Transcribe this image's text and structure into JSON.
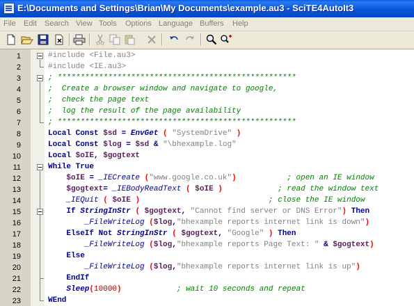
{
  "window": {
    "title": "E:\\Documents and Settings\\Brian\\My Documents\\example.au3 - SciTE4AutoIt3"
  },
  "menu": {
    "items": [
      "File",
      "Edit",
      "Search",
      "View",
      "Tools",
      "Options",
      "Language",
      "Buffers",
      "Help"
    ]
  },
  "toolbar": {
    "buttons": [
      "new-file-icon",
      "open-folder-icon",
      "save-icon",
      "close-file-icon",
      "print-icon",
      "cut-icon",
      "copy-icon",
      "paste-icon",
      "delete-icon",
      "undo-icon",
      "redo-icon",
      "find-icon",
      "replace-icon"
    ]
  },
  "colors": {
    "title_bar": "#0a55dd",
    "keyword": "#000090",
    "comment": "#008000",
    "string": "#808080",
    "variable": "#5a1e5a",
    "paren": "#ff0000",
    "number": "#a00000"
  },
  "editor": {
    "lines": [
      [
        [
          "i",
          "#include "
        ],
        [
          "s",
          "<File.au3>"
        ]
      ],
      [
        [
          "i",
          "#include "
        ],
        [
          "s",
          "<IE.au3>"
        ]
      ],
      [
        [
          "c",
          "; ****************************************************"
        ]
      ],
      [
        [
          "c",
          ";  Create a browser window and navigate to google,"
        ]
      ],
      [
        [
          "c",
          ";  check the page text"
        ]
      ],
      [
        [
          "c",
          ";  log the result of the page availability"
        ]
      ],
      [
        [
          "c",
          "; ****************************************************"
        ]
      ],
      [
        [
          "k",
          "Local Const "
        ],
        [
          "v",
          "$sd"
        ],
        [
          "o",
          " = "
        ],
        [
          "f",
          "EnvGet"
        ],
        [
          "p",
          " ( "
        ],
        [
          "s",
          "\"SystemDrive\""
        ],
        [
          "p",
          " )"
        ]
      ],
      [
        [
          "k",
          "Local Const "
        ],
        [
          "v",
          "$log"
        ],
        [
          "o",
          " = "
        ],
        [
          "v",
          "$sd"
        ],
        [
          "o",
          " & "
        ],
        [
          "s",
          "\"\\bhexample.log\""
        ]
      ],
      [
        [
          "k",
          "Local "
        ],
        [
          "v",
          "$oIE"
        ],
        [
          "o",
          ", "
        ],
        [
          "v",
          "$gogtext"
        ]
      ],
      [
        [
          "k",
          "While True"
        ]
      ],
      [
        [
          "t",
          "    "
        ],
        [
          "v",
          "$oIE"
        ],
        [
          "o",
          " = "
        ],
        [
          "uf",
          "_IECreate"
        ],
        [
          "p",
          " ("
        ],
        [
          "s",
          "\"www.google.co.uk\""
        ],
        [
          "p",
          ")"
        ],
        [
          "t",
          "           "
        ],
        [
          "c",
          "; open an IE window"
        ]
      ],
      [
        [
          "t",
          "    "
        ],
        [
          "v",
          "$gogtext"
        ],
        [
          "o",
          "= "
        ],
        [
          "uf",
          "_IEBodyReadText"
        ],
        [
          "p",
          " ( "
        ],
        [
          "v",
          "$oIE"
        ],
        [
          "p",
          " )"
        ],
        [
          "t",
          "            "
        ],
        [
          "c",
          "; read the window text"
        ]
      ],
      [
        [
          "t",
          "    "
        ],
        [
          "uf",
          "_IEQuit"
        ],
        [
          "p",
          " ( "
        ],
        [
          "v",
          "$oIE"
        ],
        [
          "p",
          " )"
        ],
        [
          "t",
          "                            "
        ],
        [
          "c",
          "; close the IE window"
        ]
      ],
      [
        [
          "t",
          "    "
        ],
        [
          "k",
          "If "
        ],
        [
          "f",
          "StringInStr"
        ],
        [
          "p",
          " ( "
        ],
        [
          "v",
          "$gogtext"
        ],
        [
          "o",
          ", "
        ],
        [
          "s",
          "\"Cannot find server or DNS Error\""
        ],
        [
          "p",
          ")"
        ],
        [
          "k",
          " Then"
        ]
      ],
      [
        [
          "t",
          "        "
        ],
        [
          "uf",
          "_FileWriteLog"
        ],
        [
          "p",
          " ("
        ],
        [
          "v",
          "$log"
        ],
        [
          "o",
          ","
        ],
        [
          "s",
          "\"bhexample reports internet link is down\""
        ],
        [
          "p",
          ")"
        ]
      ],
      [
        [
          "t",
          "    "
        ],
        [
          "k",
          "ElseIf Not "
        ],
        [
          "f",
          "StringInStr"
        ],
        [
          "p",
          " ( "
        ],
        [
          "v",
          "$gogtext"
        ],
        [
          "o",
          ", "
        ],
        [
          "s",
          "\"Google\""
        ],
        [
          "p",
          " )"
        ],
        [
          "k",
          " Then"
        ]
      ],
      [
        [
          "t",
          "        "
        ],
        [
          "uf",
          "_FileWriteLog"
        ],
        [
          "p",
          " ("
        ],
        [
          "v",
          "$log"
        ],
        [
          "o",
          ","
        ],
        [
          "s",
          "\"bhexample reports Page Text: \""
        ],
        [
          "o",
          " & "
        ],
        [
          "v",
          "$gogtext"
        ],
        [
          "p",
          ")"
        ]
      ],
      [
        [
          "t",
          "    "
        ],
        [
          "k",
          "Else"
        ]
      ],
      [
        [
          "t",
          "        "
        ],
        [
          "uf",
          "_FileWriteLog"
        ],
        [
          "p",
          " ("
        ],
        [
          "v",
          "$log"
        ],
        [
          "o",
          ","
        ],
        [
          "s",
          "\"bhexample reports internet link is up\""
        ],
        [
          "p",
          ")"
        ]
      ],
      [
        [
          "t",
          "    "
        ],
        [
          "k",
          "EndIf"
        ]
      ],
      [
        [
          "t",
          "    "
        ],
        [
          "f",
          "Sleep"
        ],
        [
          "p",
          "("
        ],
        [
          "n",
          "10000"
        ],
        [
          "p",
          ")"
        ],
        [
          "t",
          "            "
        ],
        [
          "c",
          "; wait 10 seconds and repeat"
        ]
      ],
      [
        [
          "k",
          "WEnd"
        ]
      ]
    ]
  }
}
